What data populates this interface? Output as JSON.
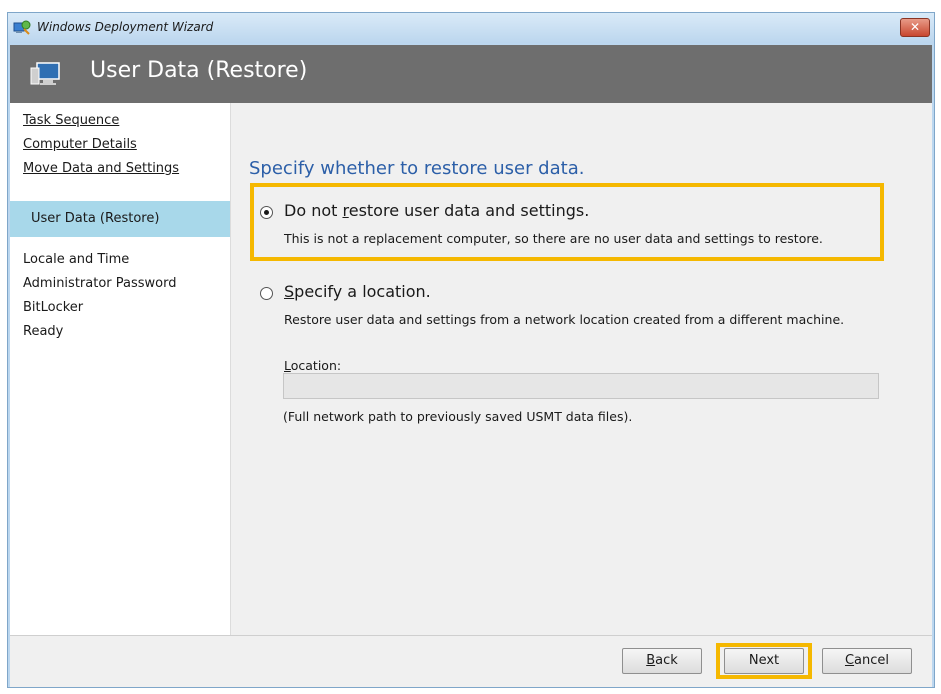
{
  "window": {
    "title": "Windows Deployment Wizard",
    "close_glyph": "✕"
  },
  "header": {
    "title": "User Data (Restore)",
    "icon": "computer-monitor-icon"
  },
  "sidebar": {
    "items": [
      {
        "label": "Task Sequence",
        "state": "completed-link"
      },
      {
        "label": "Computer Details",
        "state": "completed-link"
      },
      {
        "label": "Move Data and Settings",
        "state": "completed-link"
      },
      {
        "label": "User Data (Restore)",
        "state": "current"
      },
      {
        "label": "Locale and Time",
        "state": "pending"
      },
      {
        "label": "Administrator Password",
        "state": "pending"
      },
      {
        "label": "BitLocker",
        "state": "pending"
      },
      {
        "label": "Ready",
        "state": "pending"
      }
    ],
    "selected_color": "#a8d8ea"
  },
  "main": {
    "heading": "Specify whether to restore user data.",
    "options": [
      {
        "label_pre": "Do not ",
        "label_accel": "r",
        "label_post": "estore user data and settings.",
        "description": "This is not a replacement computer, so there are no user data and settings to restore.",
        "checked": true
      },
      {
        "label_pre": "",
        "label_accel": "S",
        "label_post": "pecify a location.",
        "description": "Restore user data and settings from a network location created from a different machine.",
        "checked": false
      }
    ],
    "location": {
      "label_accel": "L",
      "label_post": "ocation:",
      "value": "",
      "hint": "(Full network path to previously saved USMT data files)."
    },
    "heading_color": "#2c5fa8",
    "highlight_color": "#f5b800"
  },
  "footer": {
    "back": {
      "accel": "B",
      "rest": "ack"
    },
    "next": {
      "label": "Next"
    },
    "cancel": {
      "accel": "C",
      "rest": "ancel"
    }
  }
}
